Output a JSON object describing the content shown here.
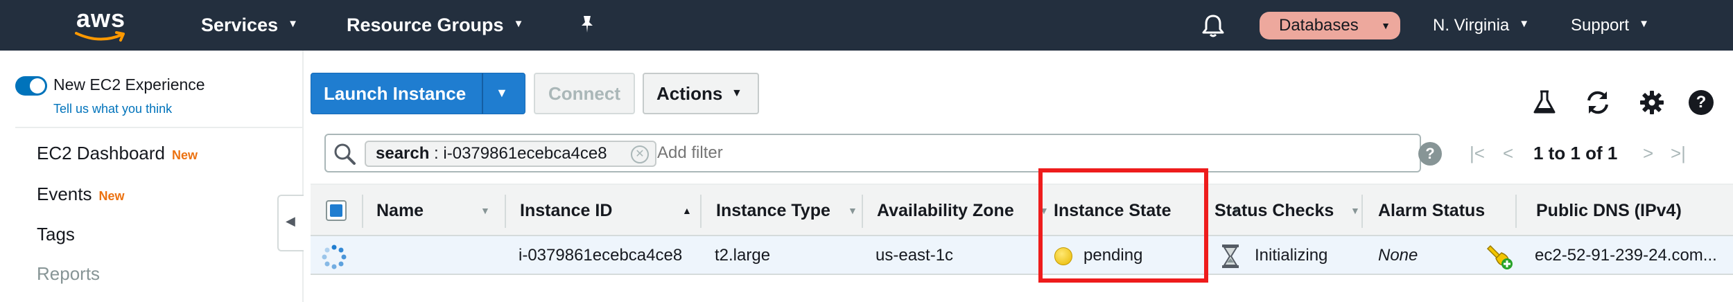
{
  "topnav": {
    "logo_text": "aws",
    "services_label": "Services",
    "resource_groups_label": "Resource Groups",
    "databases_label": "Databases",
    "region_label": "N. Virginia",
    "support_label": "Support",
    "accent_color": "#ff9900",
    "background_color": "#232f3e"
  },
  "sidebar": {
    "experience_label": "New EC2 Experience",
    "feedback_link": "Tell us what you think",
    "items": [
      {
        "label": "EC2 Dashboard",
        "badge": "New"
      },
      {
        "label": "Events",
        "badge": "New"
      },
      {
        "label": "Tags",
        "badge": ""
      },
      {
        "label": "Reports",
        "badge": ""
      }
    ]
  },
  "toolbar": {
    "launch_label": "Launch Instance",
    "connect_label": "Connect",
    "actions_label": "Actions"
  },
  "search": {
    "token_key": "search",
    "token_value": "i-0379861ecebca4ce8",
    "placeholder": "Add filter",
    "pagination": "1 to 1 of 1"
  },
  "table": {
    "columns": [
      "Name",
      "Instance ID",
      "Instance Type",
      "Availability Zone",
      "Instance State",
      "Status Checks",
      "Alarm Status",
      "Public DNS (IPv4)"
    ],
    "rows": [
      {
        "name": "",
        "instance_id": "i-0379861ecebca4ce8",
        "instance_type": "t2.large",
        "availability_zone": "us-east-1c",
        "instance_state": "pending",
        "status_checks": "Initializing",
        "alarm_status": "None",
        "public_dns": "ec2-52-91-239-24.com..."
      }
    ]
  },
  "colors": {
    "primary_button": "#1f7dd0",
    "pending_dot": "#f2c500",
    "highlight": "#ee1c1c",
    "new_badge": "#ec7211"
  }
}
